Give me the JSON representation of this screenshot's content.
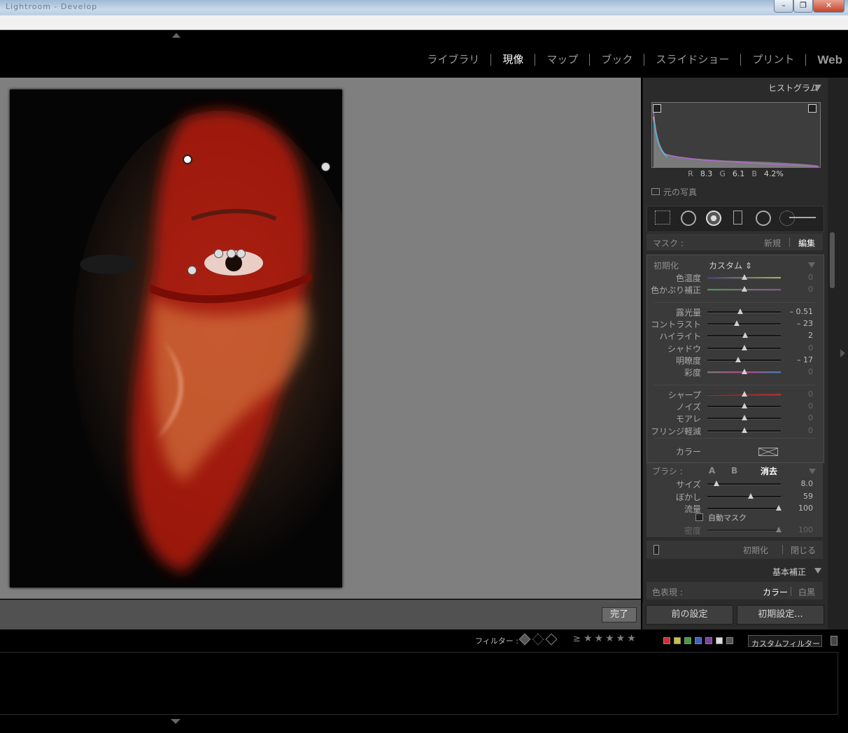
{
  "window": {
    "title": "Lightroom - Develop",
    "minimize_label": "–",
    "maximize_label": "❐",
    "close_label": "✕"
  },
  "modules": [
    "ライブラリ",
    "現像",
    "マップ",
    "ブック",
    "スライドショー",
    "プリント",
    "Web"
  ],
  "active_module": "現像",
  "toolbar": {
    "done_label": "完了"
  },
  "histogram": {
    "title": "ヒストグラム",
    "readout": {
      "r_label": "R",
      "r_value": "8.3",
      "g_label": "G",
      "g_value": "6.1",
      "b_label": "B",
      "b_value": "4.2",
      "unit": "%"
    },
    "original_photo_label": "元の写真"
  },
  "mask": {
    "label": "マスク :",
    "new_label": "新規",
    "edit_label": "編集"
  },
  "adjust": {
    "reset_label": "初期化",
    "preset_value": "カスタム ⇕",
    "groups": [
      [
        {
          "label": "色温度",
          "value": "0",
          "pos": 0.5
        },
        {
          "label": "色かぶり補正",
          "value": "0",
          "pos": 0.5
        }
      ],
      [
        {
          "label": "露光量",
          "value": "– 0.51",
          "pos": 0.45
        },
        {
          "label": "コントラスト",
          "value": "– 23",
          "pos": 0.4
        },
        {
          "label": "ハイライト",
          "value": "2",
          "pos": 0.51
        },
        {
          "label": "シャドウ",
          "value": "0",
          "pos": 0.5
        },
        {
          "label": "明瞭度",
          "value": "– 17",
          "pos": 0.42
        },
        {
          "label": "彩度",
          "value": "0",
          "pos": 0.5
        }
      ],
      [
        {
          "label": "シャープ",
          "value": "0",
          "pos": 0.5
        },
        {
          "label": "ノイズ",
          "value": "0",
          "pos": 0.5
        },
        {
          "label": "モアレ",
          "value": "0",
          "pos": 0.5
        },
        {
          "label": "フリンジ軽減",
          "value": "0",
          "pos": 0.5
        }
      ]
    ],
    "color_label": "カラー"
  },
  "brush": {
    "label": "ブラシ :",
    "a_label": "A",
    "b_label": "B",
    "erase_label": "消去",
    "sliders": [
      {
        "label": "サイズ",
        "value": "8.0",
        "pos": 0.12
      },
      {
        "label": "ぼかし",
        "value": "59",
        "pos": 0.59
      },
      {
        "label": "流量",
        "value": "100",
        "pos": 0.97
      }
    ],
    "auto_mask_label": "自動マスク",
    "density": {
      "label": "密度",
      "value": "100",
      "pos": 0.97
    }
  },
  "panel_footer": {
    "reset_label": "初期化",
    "close_label": "閉じる"
  },
  "basic": {
    "title": "基本補正",
    "treatment_label": "色表現 :",
    "color_label": "カラー",
    "bw_label": "白黒"
  },
  "bottom_buttons": {
    "previous_label": "前の設定",
    "reset_label": "初期設定..."
  },
  "filter": {
    "label": "フィルター :",
    "gte_label": "≥",
    "stars": "★★★★★",
    "custom_filter_label": "カスタムフィルター ⇕",
    "swatch_colors": [
      "#d03030",
      "#c8c040",
      "#40a040",
      "#4060c0",
      "#8040a0",
      "#dddddd",
      "#555555"
    ]
  },
  "colors": {
    "mask_overlay": "#c41a0b",
    "panel_bg": "#2b2b2b",
    "workspace_bg": "#7f7f7f"
  }
}
